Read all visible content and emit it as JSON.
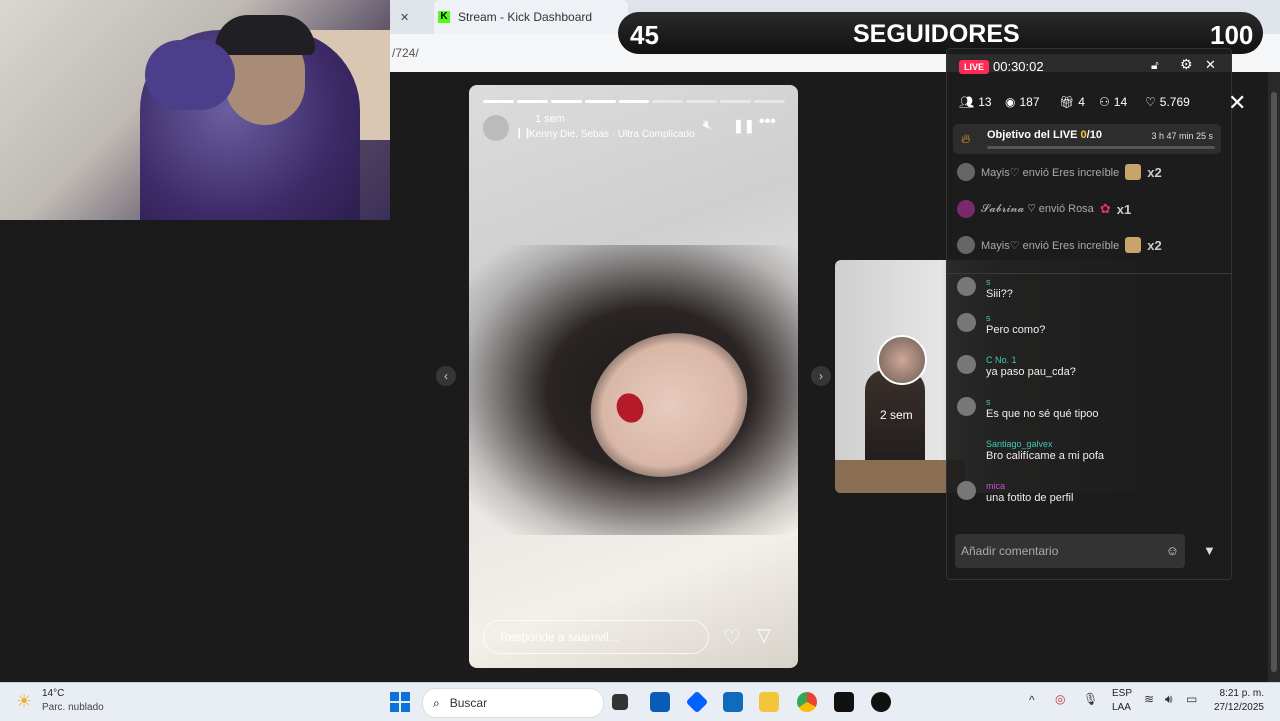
{
  "browser": {
    "tabs": [
      {
        "title": "",
        "close": "✕"
      },
      {
        "title": "Stream - Kick Dashboard",
        "close": "✕"
      }
    ],
    "address": "/724/"
  },
  "banner": {
    "count": "45",
    "label": "SEGUIDORES",
    "goal": "100"
  },
  "story": {
    "time": "1 sem",
    "music": "Kenny Die, Sebas · Ultra Complicado",
    "progress_segments": 9,
    "progress_done": 5,
    "reply_placeholder": "Responde a saamvil...",
    "next_time": "2 sem"
  },
  "live": {
    "badge": "LIVE",
    "timer": "00:30:02",
    "stats": {
      "viewers": "13",
      "views": "187",
      "gifts": "4",
      "follows": "14",
      "likes": "5.769"
    },
    "goal": {
      "label": "Objetivo del LIVE",
      "progress": "0",
      "total": "/10",
      "remaining": "3 h 47 min 25 s"
    },
    "gifts": [
      {
        "text": "Mayis♡ envió Eres increíble",
        "mult": "x2"
      },
      {
        "text": "𝓢𝓪𝓫𝓻𝓲𝓷𝓪 ♡ envió Rosa",
        "mult": "x1"
      },
      {
        "text": "Mayis♡ envió Eres increíble",
        "mult": "x2"
      }
    ],
    "chats": [
      {
        "user": "s",
        "msg": "Siii??"
      },
      {
        "user": "s",
        "msg": "Pero como?"
      },
      {
        "user": "C  No. 1",
        "msg": "ya paso pau_cda?"
      },
      {
        "user": "s",
        "msg": "Es que no sé qué tipoo"
      },
      {
        "user": "Santiago_galvex",
        "msg": "Bro califícame a mi pofa"
      },
      {
        "user": "mica",
        "msg": "una fotito de perfil"
      }
    ],
    "comment_placeholder": "Añadir comentario"
  },
  "taskbar": {
    "weather_temp": "14°C",
    "weather_desc": "Parc. nublado",
    "search": "Buscar",
    "lang1": "ESP",
    "lang2": "LAA",
    "time": "8:21 p. m.",
    "date": "27/12/2025"
  },
  "colors": {
    "live_red": "#fe2c55",
    "chat_user": "#3ec9b8",
    "kick_green": "#53fc18"
  }
}
